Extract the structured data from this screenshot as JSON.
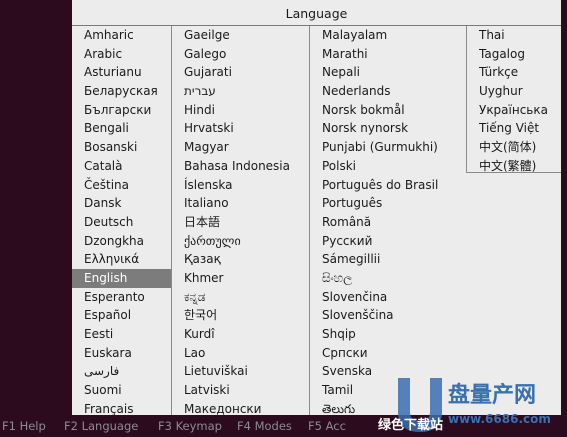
{
  "dialog": {
    "title": "Language",
    "columns": [
      [
        "Amharic",
        "Arabic",
        "Asturianu",
        "Беларуская",
        "Български",
        "Bengali",
        "Bosanski",
        "Català",
        "Čeština",
        "Dansk",
        "Deutsch",
        "Dzongkha",
        "Ελληνικά",
        "English",
        "Esperanto",
        "Español",
        "Eesti",
        "Euskara",
        "فارسی",
        "Suomi",
        "Français"
      ],
      [
        "Gaeilge",
        "Galego",
        "Gujarati",
        "עברית",
        "Hindi",
        "Hrvatski",
        "Magyar",
        "Bahasa Indonesia",
        "Íslenska",
        "Italiano",
        "日本語",
        "ქართული",
        "Қазақ",
        "Khmer",
        "ಕನ್ನಡ",
        "한국어",
        "Kurdî",
        "Lao",
        "Lietuviškai",
        "Latviski",
        "Македонски"
      ],
      [
        "Malayalam",
        "Marathi",
        "Nepali",
        "Nederlands",
        "Norsk bokmål",
        "Norsk nynorsk",
        "Punjabi (Gurmukhi)",
        "Polski",
        "Português do Brasil",
        "Português",
        "Română",
        "Русский",
        "Sámegillii",
        "සිංහල",
        "Slovenčina",
        "Slovenščina",
        "Shqip",
        "Српски",
        "Svenska",
        "Tamil",
        "తెలుగు"
      ],
      [
        "Thai",
        "Tagalog",
        "Türkçe",
        "Uyghur",
        "Українська",
        "Tiếng Việt",
        "中文(简体)",
        "中文(繁體)"
      ]
    ],
    "selected": "English"
  },
  "footer": [
    {
      "key": "F1",
      "label": "Help"
    },
    {
      "key": "F2",
      "label": "Language"
    },
    {
      "key": "F3",
      "label": "Keymap"
    },
    {
      "key": "F4",
      "label": "Modes"
    },
    {
      "key": "F5",
      "label": "Accessibility"
    }
  ],
  "footer_text": {
    "f1": "F1 Help",
    "f2": "F2 Language",
    "f3": "F3 Keymap",
    "f4": "F4 Modes",
    "f5": "F5 Acc"
  },
  "watermark": {
    "brand": "盘量产网",
    "url": "www.6686.com",
    "overlay": "绿色下载站"
  },
  "colors": {
    "background": "#2c0b1f",
    "dialog": "#ececec",
    "selected": "#7c7c7c",
    "watermark": "#3a6fb0"
  }
}
